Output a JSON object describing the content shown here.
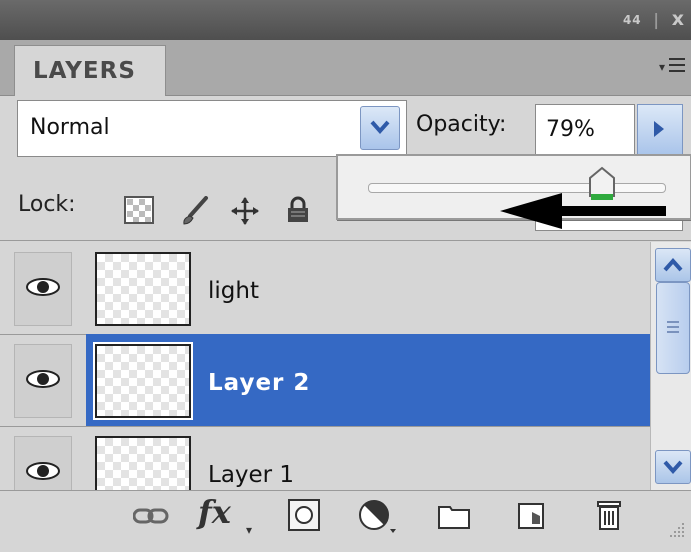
{
  "window": {
    "controls": {
      "collapse_icon": "double-chevron-left-icon",
      "close_icon": "close-icon",
      "collapse_text": "44",
      "close_text": "x"
    }
  },
  "panel": {
    "tab_label": "LAYERS",
    "menu_icon": "panel-menu-icon"
  },
  "blend": {
    "mode": "Normal",
    "opacity_label": "Opacity:",
    "opacity_value": "79%",
    "opacity_slider_fraction": 0.79
  },
  "lock": {
    "label": "Lock:",
    "icons": [
      "lock-transparent-pixels-icon",
      "lock-image-pixels-icon",
      "lock-position-icon",
      "lock-all-icon"
    ]
  },
  "layers": [
    {
      "name": "light",
      "visible": true,
      "selected": false
    },
    {
      "name": "Layer 2",
      "visible": true,
      "selected": true
    },
    {
      "name": "Layer 1",
      "visible": true,
      "selected": false
    }
  ],
  "bottom_bar": {
    "icons": [
      "link-layers-icon",
      "layer-style-fx-icon",
      "layer-mask-icon",
      "adjustment-layer-icon",
      "new-group-folder-icon",
      "new-layer-icon",
      "delete-trash-icon"
    ],
    "fx_text": "fx"
  },
  "colors": {
    "selection": "#3569c4",
    "panel_bg": "#d6d6d6",
    "titlebar": "#585858"
  }
}
